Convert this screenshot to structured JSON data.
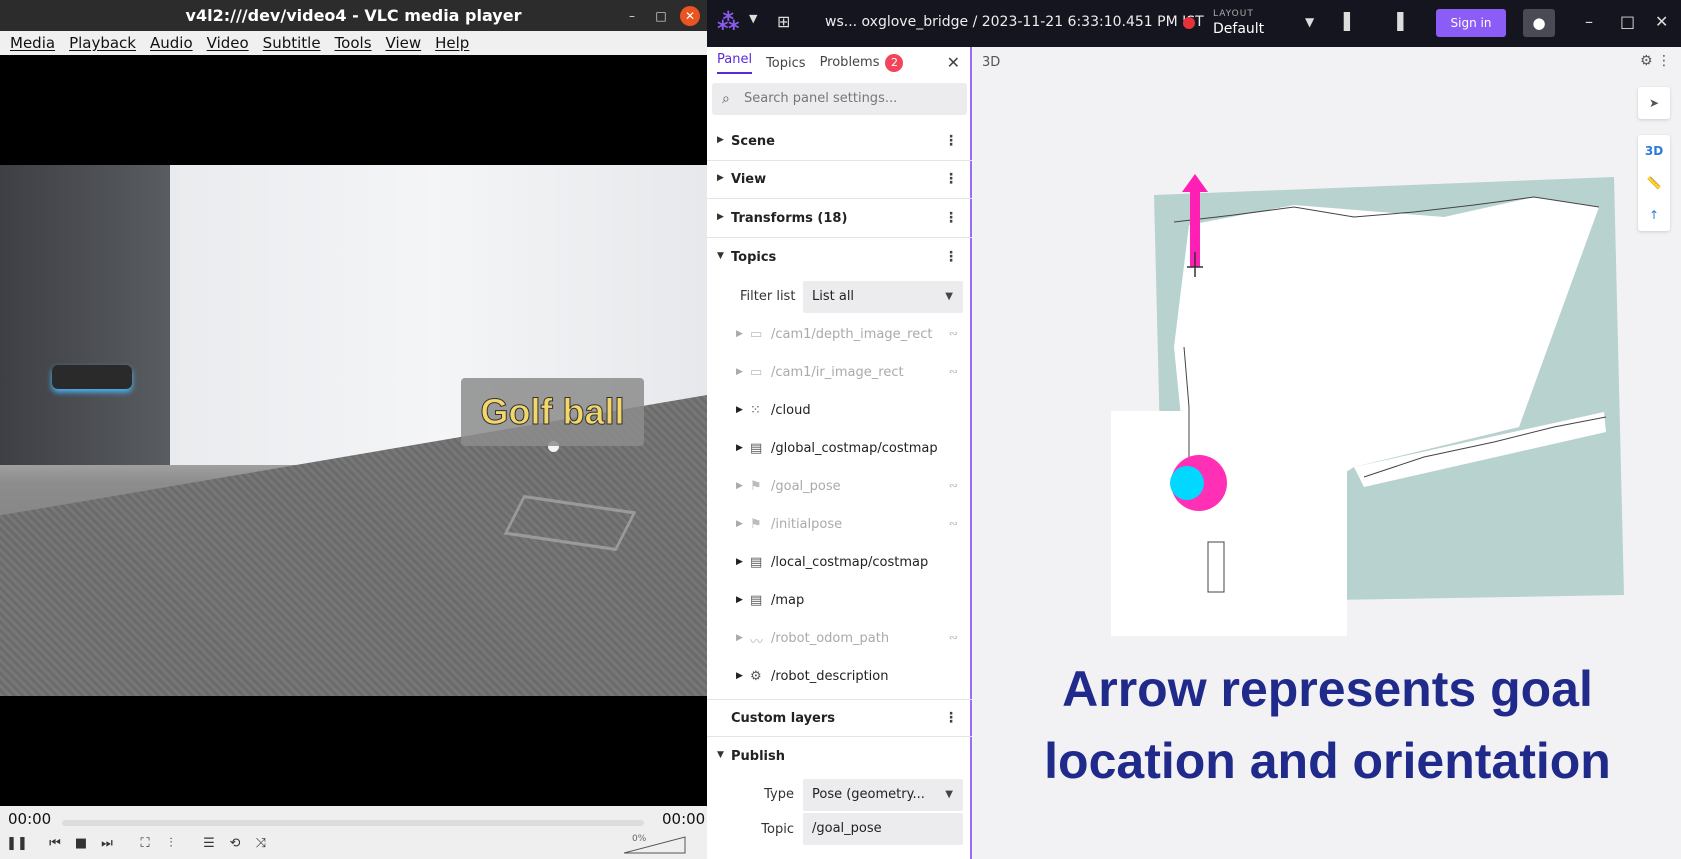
{
  "vlc": {
    "title": "v4l2:///dev/video4 - VLC media player",
    "menu": [
      "Media",
      "Playback",
      "Audio",
      "Video",
      "Subtitle",
      "Tools",
      "View",
      "Help"
    ],
    "caption": "Golf ball",
    "time_elapsed": "00:00",
    "time_total": "00:00",
    "volume_pct": "0%",
    "window_buttons": {
      "minimize": "–",
      "maximize": "□",
      "close": "✕"
    }
  },
  "foxglove": {
    "source": "ws... oxglove_bridge / 2023-11-21 6:33:10.451 PM IST",
    "layout_label": "LAYOUT",
    "layout_value": "Default",
    "sign_in": "Sign in",
    "window_buttons": {
      "minimize": "–",
      "maximize": "□",
      "close": "✕"
    },
    "sidebar": {
      "tabs": [
        {
          "label": "Panel"
        },
        {
          "label": "Topics"
        },
        {
          "label": "Problems",
          "badge": "2"
        }
      ],
      "search_placeholder": "Search panel settings...",
      "sections": {
        "scene": "Scene",
        "view": "View",
        "transforms": "Transforms (18)",
        "topics": "Topics",
        "custom_layers": "Custom layers",
        "publish": "Publish"
      },
      "filter_label": "Filter list",
      "filter_value": "List all",
      "topics": [
        {
          "name": "/cam1/depth_image_rect",
          "icon": "image-icon",
          "visible": false
        },
        {
          "name": "/cam1/ir_image_rect",
          "icon": "image-icon",
          "visible": false
        },
        {
          "name": "/cloud",
          "icon": "pointcloud-icon",
          "visible": true
        },
        {
          "name": "/global_costmap/costmap",
          "icon": "grid-icon",
          "visible": true
        },
        {
          "name": "/goal_pose",
          "icon": "flag-icon",
          "visible": false
        },
        {
          "name": "/initialpose",
          "icon": "flag-icon",
          "visible": false
        },
        {
          "name": "/local_costmap/costmap",
          "icon": "grid-icon",
          "visible": true
        },
        {
          "name": "/map",
          "icon": "grid-icon",
          "visible": true
        },
        {
          "name": "/robot_odom_path",
          "icon": "path-icon",
          "visible": false
        },
        {
          "name": "/robot_description",
          "icon": "robot-icon",
          "visible": true
        }
      ],
      "publish": {
        "type_label": "Type",
        "type_value": "Pose (geometry...",
        "topic_label": "Topic",
        "topic_value": "/goal_pose"
      }
    },
    "panel3d": {
      "title": "3D",
      "mode_3d": "3D",
      "overlay_line1": "Arrow represents goal",
      "overlay_line2": "location and orientation"
    }
  },
  "colors": {
    "vlc_close": "#e95420",
    "fox_accent": "#8b5cf6",
    "fox_badge": "#f2455c",
    "overlay_text": "#1f2a8a",
    "goal_arrow": "#ff1fb4",
    "map_teal": "#b8d2d0"
  }
}
